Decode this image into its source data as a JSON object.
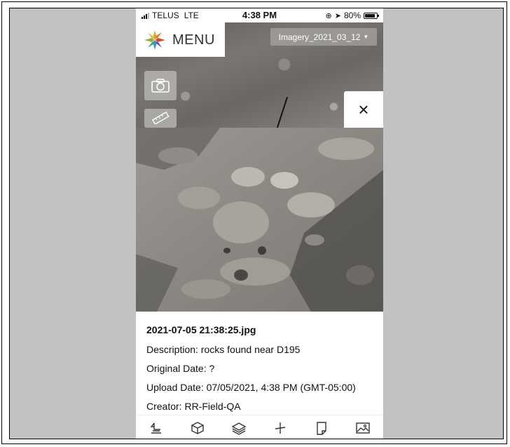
{
  "status_bar": {
    "carrier": "TELUS",
    "network": "LTE",
    "time": "4:38 PM",
    "battery": "80%",
    "battery_level": 0.8
  },
  "map": {
    "menu_label": "MENU",
    "imagery_select": "Imagery_2021_03_12",
    "camera_icon": "camera-icon",
    "measure_icon": "ruler-icon",
    "close_label": "×"
  },
  "photo": {
    "filename": "2021-07-05 21:38:25.jpg",
    "description": "Description: rocks found near D195",
    "original_date": "Original Date: ?",
    "upload_date": "Upload Date: 07/05/2021, 4:38 PM (GMT-05:00)",
    "creator": "Creator: RR-Field-QA"
  },
  "toolbar": {
    "items": [
      {
        "icon": "survey-icon"
      },
      {
        "icon": "cube-icon"
      },
      {
        "icon": "layers-icon"
      },
      {
        "icon": "pin-icon"
      },
      {
        "icon": "note-icon"
      },
      {
        "icon": "image-icon"
      }
    ]
  },
  "colors": {
    "page_background": "#c2c2c2",
    "panel": "#ffffff",
    "map_dark": "#6a6763"
  }
}
